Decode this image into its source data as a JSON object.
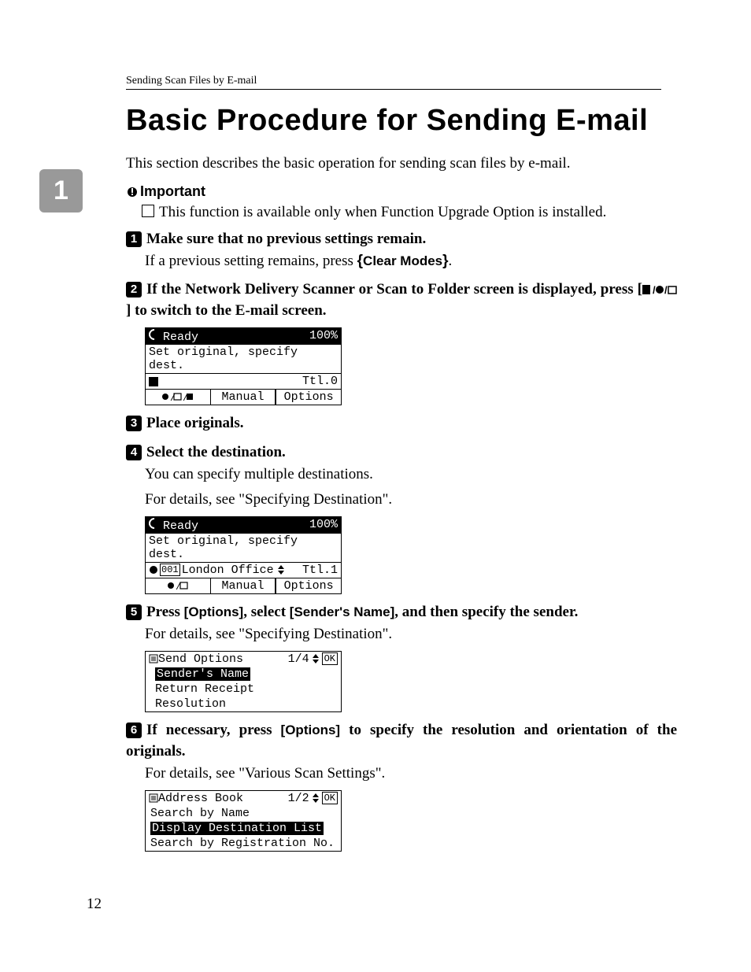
{
  "running_head": "Sending Scan Files by E-mail",
  "chapter_tab": "1",
  "page_number": "12",
  "title": "Basic Procedure for Sending E-mail",
  "intro": "This section describes the basic operation for sending scan files by e-mail.",
  "important": {
    "label": "Important",
    "item": "This function is available only when Function Upgrade Option is installed."
  },
  "steps": {
    "s1": {
      "num": "1",
      "head": "Make sure that no previous settings remain.",
      "body_pre": "If a previous setting remains, press ",
      "key": "Clear Modes",
      "body_post": "."
    },
    "s2": {
      "num": "2",
      "head_pre": "If the Network Delivery Scanner or Scan to Folder screen is displayed, press [",
      "head_post": "] to switch to the E-mail screen."
    },
    "s3": {
      "num": "3",
      "head": "Place originals."
    },
    "s4": {
      "num": "4",
      "head": "Select the destination.",
      "body1": "You can specify multiple destinations.",
      "body2": "For details, see \"Specifying Destination\"."
    },
    "s5": {
      "num": "5",
      "head_pre": "Press ",
      "key1": "[Options]",
      "head_mid": ", select ",
      "key2": "[Sender's Name]",
      "head_post": ", and then specify the sender.",
      "body": "For details, see \"Specifying Destination\"."
    },
    "s6": {
      "num": "6",
      "head_pre": "If necessary, press ",
      "key1": "[Options]",
      "head_post": " to specify the resolution and orientation of the originals.",
      "body": "For details, see \"Various Scan Settings\"."
    }
  },
  "screens": {
    "scr1": {
      "status": "Ready",
      "percent": "100%",
      "line1": "Set original, specify dest.",
      "ttl": "Ttl.0",
      "tab2": "Manual",
      "tab3": "Options"
    },
    "scr2": {
      "status": "Ready",
      "percent": "100%",
      "line1": "Set original, specify dest.",
      "dest_id": "001",
      "dest_name": "London Office",
      "ttl": "Ttl.1",
      "tab2": "Manual",
      "tab3": "Options"
    },
    "scr3": {
      "title": "Send Options",
      "pager": "1/4",
      "ok": "OK",
      "item1": "Sender's Name",
      "item2": "Return Receipt",
      "item3": "Resolution"
    },
    "scr4": {
      "title": "Address Book",
      "pager": "1/2",
      "ok": "OK",
      "item1": "Search by Name",
      "item2": "Display Destination List",
      "item3": "Search by Registration No."
    }
  }
}
